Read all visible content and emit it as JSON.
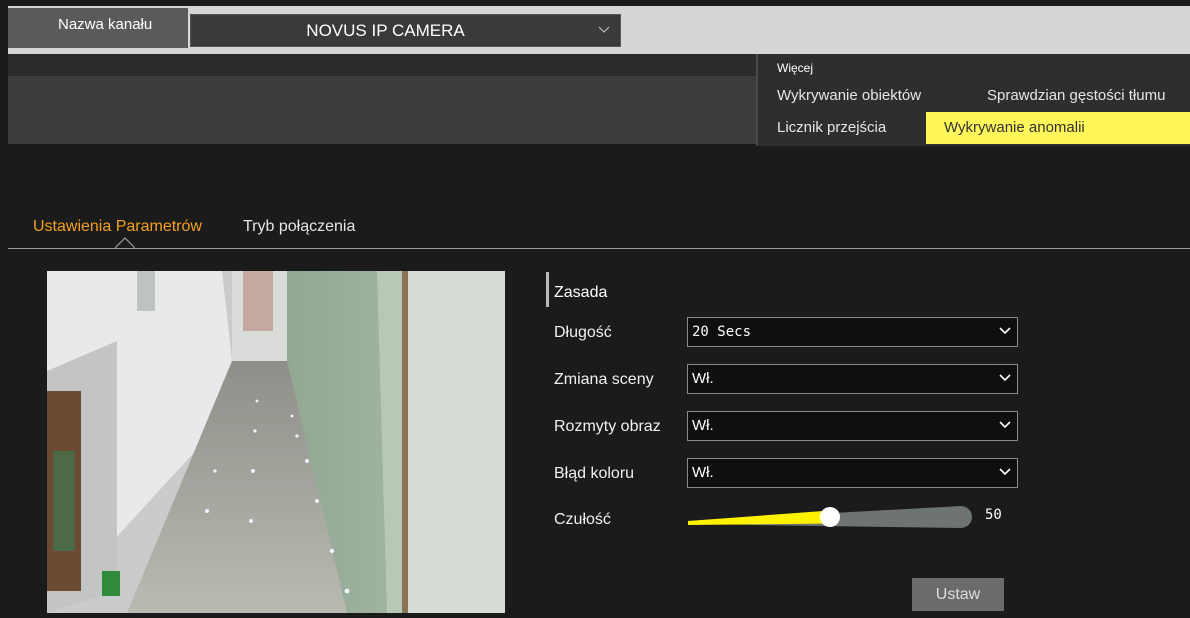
{
  "channel": {
    "label": "Nazwa kanału",
    "selected": "NOVUS IP CAMERA"
  },
  "more_menu": {
    "title": "Więcej",
    "items": [
      "Wykrywanie obiektów",
      "Sprawdzian gęstości tłumu",
      "Licznik przejścia",
      "Wykrywanie anomalii"
    ],
    "active": "Wykrywanie anomalii"
  },
  "tabs": {
    "params": "Ustawienia Parametrów",
    "connection": "Tryb połączenia",
    "active": "Ustawienia Parametrów"
  },
  "form": {
    "section_title": "Zasada",
    "length": {
      "label": "Długość",
      "value": "20 Secs"
    },
    "scene_change": {
      "label": "Zmiana sceny",
      "value": "Wł."
    },
    "blurred_image": {
      "label": "Rozmyty obraz",
      "value": "Wł."
    },
    "color_error": {
      "label": "Błąd koloru",
      "value": "Wł."
    },
    "sensitivity": {
      "label": "Czułość",
      "value": "50",
      "fraction": 0.5
    }
  },
  "buttons": {
    "set": "Ustaw"
  },
  "colors": {
    "active_tab": "#f4a01d",
    "highlight": "#fff659",
    "slider_fill": "#fff200",
    "slider_track": "#6e7472"
  }
}
